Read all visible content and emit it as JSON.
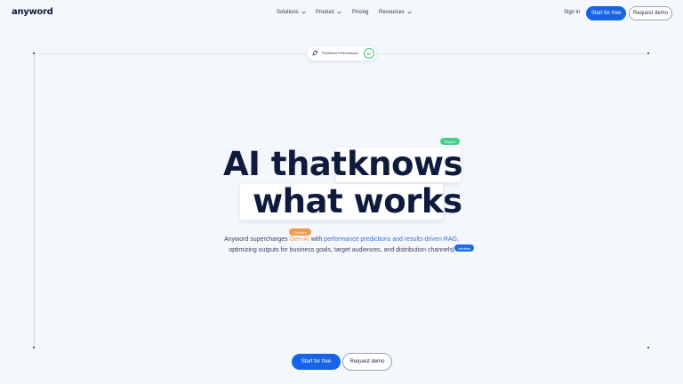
{
  "nav": {
    "logo": "anyword",
    "menu": [
      {
        "label": "Solutions",
        "chevron": "chevron-down-icon"
      },
      {
        "label": "Product",
        "chevron": "chevron-down-icon"
      },
      {
        "label": "Pricing"
      },
      {
        "label": "Resources",
        "chevron": "chevron-down-icon"
      }
    ],
    "sign_in": "Sign in",
    "start_free": "Start for free",
    "request_demo": "Request demo"
  },
  "performance_pill": {
    "icon": "rocket-icon",
    "label": "Predicted Performance",
    "score": "97",
    "score_color": "#3cc47c"
  },
  "hero": {
    "line1_plain": "AI that",
    "line1_highlight": "knows",
    "line2": "what works",
    "tags": {
      "green": "Expert",
      "orange": "Creative",
      "blue": "Intuitive"
    },
    "subtitle": {
      "part1": "Anyword supercharges ",
      "genai": "Gen-AI",
      "part2": " with ",
      "highlight": "performance predictions and results-driven RAG,",
      "line2": "optimizing outputs for business goals, target audiences, and distribution channels|"
    }
  },
  "cta": {
    "start_free": "Start for free",
    "request_demo": "Request demo"
  },
  "colors": {
    "primary": "#1565e6",
    "background": "#f4f7fc",
    "heading": "#0e1b3d",
    "orange": "#f29a49",
    "green": "#49cf8c",
    "blue_text": "#3f6fd6"
  }
}
